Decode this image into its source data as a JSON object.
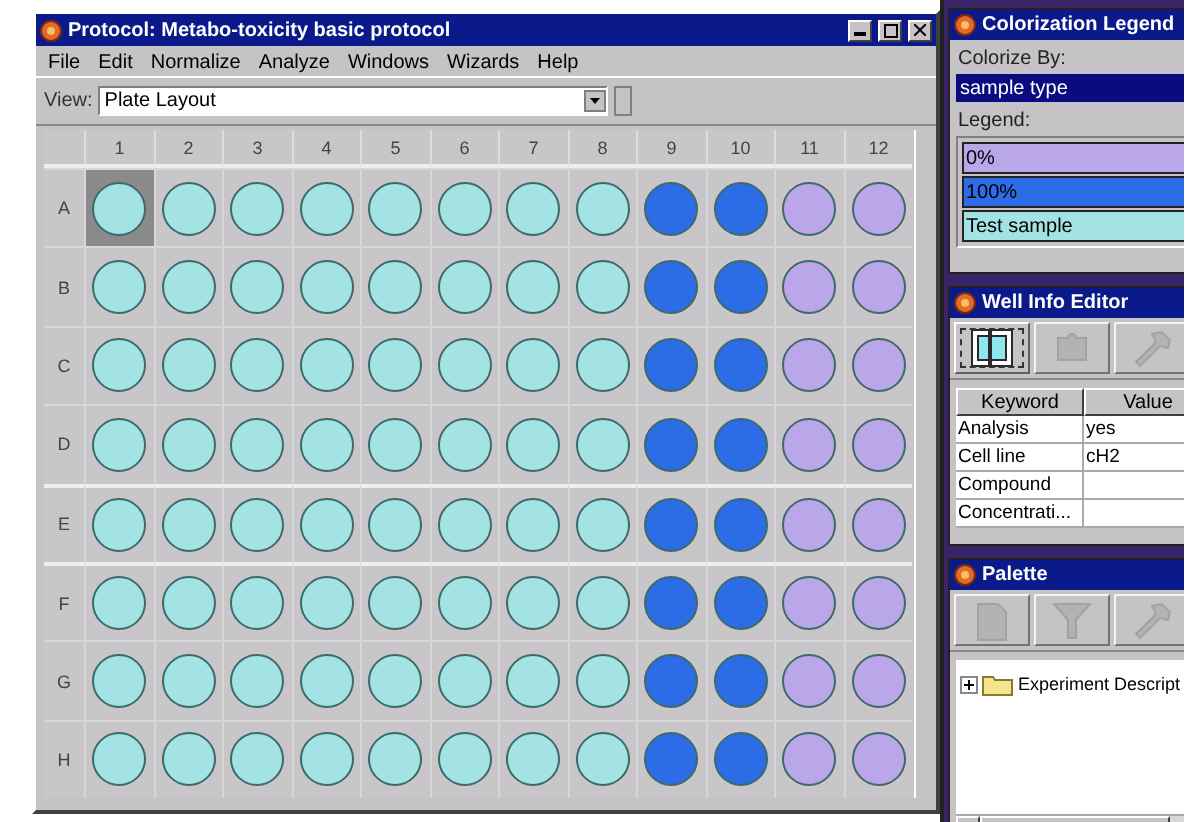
{
  "main_window": {
    "title": "Protocol: Metabo-toxicity basic protocol",
    "menu": [
      "File",
      "Edit",
      "Normalize",
      "Analyze",
      "Windows",
      "Wizards",
      "Help"
    ],
    "view": {
      "label": "View:",
      "value": "Plate Layout"
    },
    "plate": {
      "columns": [
        "1",
        "2",
        "3",
        "4",
        "5",
        "6",
        "7",
        "8",
        "9",
        "10",
        "11",
        "12"
      ],
      "rows": [
        {
          "label": "A",
          "wells": [
            {
              "color": "#a3e3e3",
              "selected": true
            },
            {
              "color": "#a3e3e3",
              "selected": false
            },
            {
              "color": "#a3e3e3",
              "selected": false
            },
            {
              "color": "#a3e3e3",
              "selected": false
            },
            {
              "color": "#a3e3e3",
              "selected": false
            },
            {
              "color": "#a3e3e3",
              "selected": false
            },
            {
              "color": "#a3e3e3",
              "selected": false
            },
            {
              "color": "#a3e3e3",
              "selected": false
            },
            {
              "color": "#2c6ce6",
              "selected": false
            },
            {
              "color": "#2c6ce6",
              "selected": false
            },
            {
              "color": "#b9a7ea",
              "selected": false
            },
            {
              "color": "#b9a7ea",
              "selected": false
            }
          ]
        },
        {
          "label": "B",
          "wells": [
            {
              "color": "#a3e3e3",
              "selected": false
            },
            {
              "color": "#a3e3e3",
              "selected": false
            },
            {
              "color": "#a3e3e3",
              "selected": false
            },
            {
              "color": "#a3e3e3",
              "selected": false
            },
            {
              "color": "#a3e3e3",
              "selected": false
            },
            {
              "color": "#a3e3e3",
              "selected": false
            },
            {
              "color": "#a3e3e3",
              "selected": false
            },
            {
              "color": "#a3e3e3",
              "selected": false
            },
            {
              "color": "#2c6ce6",
              "selected": false
            },
            {
              "color": "#2c6ce6",
              "selected": false
            },
            {
              "color": "#b9a7ea",
              "selected": false
            },
            {
              "color": "#b9a7ea",
              "selected": false
            }
          ]
        },
        {
          "label": "C",
          "wells": [
            {
              "color": "#a3e3e3",
              "selected": false
            },
            {
              "color": "#a3e3e3",
              "selected": false
            },
            {
              "color": "#a3e3e3",
              "selected": false
            },
            {
              "color": "#a3e3e3",
              "selected": false
            },
            {
              "color": "#a3e3e3",
              "selected": false
            },
            {
              "color": "#a3e3e3",
              "selected": false
            },
            {
              "color": "#a3e3e3",
              "selected": false
            },
            {
              "color": "#a3e3e3",
              "selected": false
            },
            {
              "color": "#2c6ce6",
              "selected": false
            },
            {
              "color": "#2c6ce6",
              "selected": false
            },
            {
              "color": "#b9a7ea",
              "selected": false
            },
            {
              "color": "#b9a7ea",
              "selected": false
            }
          ]
        },
        {
          "label": "D",
          "wells": [
            {
              "color": "#a3e3e3",
              "selected": false
            },
            {
              "color": "#a3e3e3",
              "selected": false
            },
            {
              "color": "#a3e3e3",
              "selected": false
            },
            {
              "color": "#a3e3e3",
              "selected": false
            },
            {
              "color": "#a3e3e3",
              "selected": false
            },
            {
              "color": "#a3e3e3",
              "selected": false
            },
            {
              "color": "#a3e3e3",
              "selected": false
            },
            {
              "color": "#a3e3e3",
              "selected": false
            },
            {
              "color": "#2c6ce6",
              "selected": false
            },
            {
              "color": "#2c6ce6",
              "selected": false
            },
            {
              "color": "#b9a7ea",
              "selected": false
            },
            {
              "color": "#b9a7ea",
              "selected": false
            }
          ]
        },
        {
          "label": "E",
          "wells": [
            {
              "color": "#a3e3e3",
              "selected": false
            },
            {
              "color": "#a3e3e3",
              "selected": false
            },
            {
              "color": "#a3e3e3",
              "selected": false
            },
            {
              "color": "#a3e3e3",
              "selected": false
            },
            {
              "color": "#a3e3e3",
              "selected": false
            },
            {
              "color": "#a3e3e3",
              "selected": false
            },
            {
              "color": "#a3e3e3",
              "selected": false
            },
            {
              "color": "#a3e3e3",
              "selected": false
            },
            {
              "color": "#2c6ce6",
              "selected": false
            },
            {
              "color": "#2c6ce6",
              "selected": false
            },
            {
              "color": "#b9a7ea",
              "selected": false
            },
            {
              "color": "#b9a7ea",
              "selected": false
            }
          ]
        },
        {
          "label": "F",
          "wells": [
            {
              "color": "#a3e3e3",
              "selected": false
            },
            {
              "color": "#a3e3e3",
              "selected": false
            },
            {
              "color": "#a3e3e3",
              "selected": false
            },
            {
              "color": "#a3e3e3",
              "selected": false
            },
            {
              "color": "#a3e3e3",
              "selected": false
            },
            {
              "color": "#a3e3e3",
              "selected": false
            },
            {
              "color": "#a3e3e3",
              "selected": false
            },
            {
              "color": "#a3e3e3",
              "selected": false
            },
            {
              "color": "#2c6ce6",
              "selected": false
            },
            {
              "color": "#2c6ce6",
              "selected": false
            },
            {
              "color": "#b9a7ea",
              "selected": false
            },
            {
              "color": "#b9a7ea",
              "selected": false
            }
          ]
        },
        {
          "label": "G",
          "wells": [
            {
              "color": "#a3e3e3",
              "selected": false
            },
            {
              "color": "#a3e3e3",
              "selected": false
            },
            {
              "color": "#a3e3e3",
              "selected": false
            },
            {
              "color": "#a3e3e3",
              "selected": false
            },
            {
              "color": "#a3e3e3",
              "selected": false
            },
            {
              "color": "#a3e3e3",
              "selected": false
            },
            {
              "color": "#a3e3e3",
              "selected": false
            },
            {
              "color": "#a3e3e3",
              "selected": false
            },
            {
              "color": "#2c6ce6",
              "selected": false
            },
            {
              "color": "#2c6ce6",
              "selected": false
            },
            {
              "color": "#b9a7ea",
              "selected": false
            },
            {
              "color": "#b9a7ea",
              "selected": false
            }
          ]
        },
        {
          "label": "H",
          "wells": [
            {
              "color": "#a3e3e3",
              "selected": false
            },
            {
              "color": "#a3e3e3",
              "selected": false
            },
            {
              "color": "#a3e3e3",
              "selected": false
            },
            {
              "color": "#a3e3e3",
              "selected": false
            },
            {
              "color": "#a3e3e3",
              "selected": false
            },
            {
              "color": "#a3e3e3",
              "selected": false
            },
            {
              "color": "#a3e3e3",
              "selected": false
            },
            {
              "color": "#a3e3e3",
              "selected": false
            },
            {
              "color": "#2c6ce6",
              "selected": false
            },
            {
              "color": "#2c6ce6",
              "selected": false
            },
            {
              "color": "#b9a7ea",
              "selected": false
            },
            {
              "color": "#b9a7ea",
              "selected": false
            }
          ]
        }
      ]
    }
  },
  "legend_panel": {
    "title": "Colorization Legend",
    "colorize_label": "Colorize By:",
    "colorize_value": "sample type",
    "legend_label": "Legend:",
    "items": [
      {
        "label": "0%",
        "color": "#b9a7ea"
      },
      {
        "label": "100%",
        "color": "#2c6ce6"
      },
      {
        "label": "Test sample",
        "color": "#a3e3e3"
      }
    ]
  },
  "well_info": {
    "title": "Well Info Editor",
    "tools": [
      {
        "kind": "layout",
        "selected": true,
        "disabled": false
      },
      {
        "kind": "puzzle",
        "selected": false,
        "disabled": true
      },
      {
        "kind": "wrench",
        "selected": false,
        "disabled": true
      }
    ],
    "columns": [
      "Keyword",
      "Value"
    ],
    "rows": [
      {
        "keyword": "Analysis",
        "value": "yes"
      },
      {
        "keyword": "Cell line",
        "value": "cH2"
      },
      {
        "keyword": "Compound",
        "value": ""
      },
      {
        "keyword": "Concentrati...",
        "value": ""
      }
    ]
  },
  "palette": {
    "title": "Palette",
    "tools": [
      {
        "kind": "document",
        "selected": false,
        "disabled": true
      },
      {
        "kind": "funnel",
        "selected": false,
        "disabled": true
      },
      {
        "kind": "wrench",
        "selected": false,
        "disabled": true
      }
    ],
    "tree": [
      {
        "label": "Experiment Descript",
        "expanded": false
      }
    ]
  }
}
